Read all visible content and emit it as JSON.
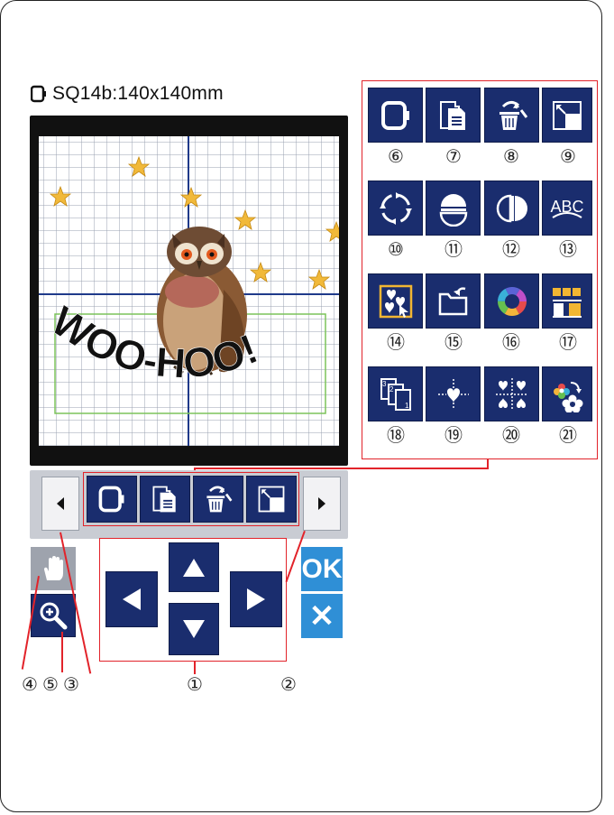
{
  "header": {
    "hoop_label": "SQ14b:140x140mm"
  },
  "canvas": {
    "lettering": "WOO-HOO!"
  },
  "callouts": [
    "①",
    "②",
    "③",
    "④",
    "⑤",
    "⑥",
    "⑦",
    "⑧",
    "⑨",
    "⑩",
    "⑪",
    "⑫",
    "⑬",
    "⑭",
    "⑮",
    "⑯",
    "⑰",
    "⑱",
    "⑲",
    "⑳",
    "㉑"
  ],
  "panel": {
    "icons": [
      "hoop-select-icon",
      "copy-icon",
      "delete-icon",
      "resize-icon",
      "rotate-icon",
      "flip-vertical-icon",
      "flip-horizontal-icon",
      "arc-text-icon",
      "group-select-icon",
      "layout-icon",
      "color-wheel-icon",
      "color-group-icon",
      "order-icon",
      "center-icon",
      "corner-layout-icon",
      "color-change-icon"
    ],
    "abc_text": "ABC"
  },
  "controls": {
    "ok_label": "OK",
    "cancel_label": "✕"
  },
  "colors": {
    "button": "#1a2d6e",
    "callout_box": "#e2232a",
    "ok": "#2f8fd6",
    "star": "#f1b93a",
    "hoop_outline": "#7cc35a",
    "axis": "#1f3a8a"
  }
}
